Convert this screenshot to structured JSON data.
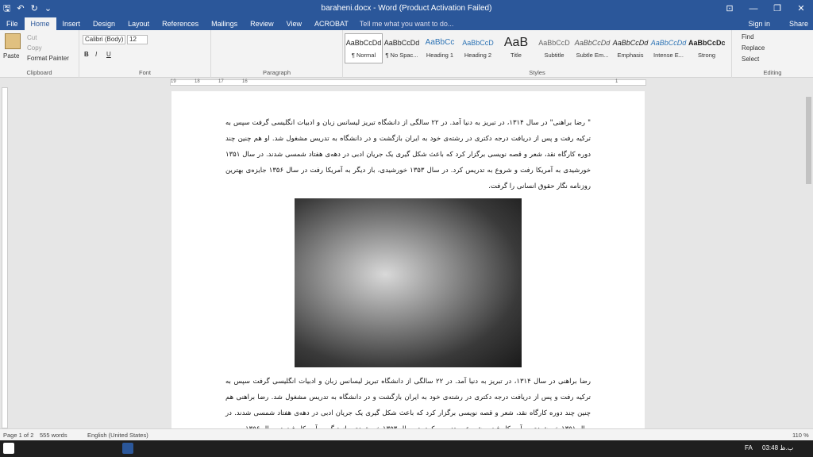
{
  "window": {
    "title": "baraheni.docx - Word (Product Activation Failed)",
    "controls": [
      "⊡",
      "—",
      "❐",
      "✕"
    ]
  },
  "qat": {
    "save": "🖫",
    "undo": "↶",
    "redo": "↻",
    "more": "⌄"
  },
  "tabs": [
    "File",
    "Home",
    "Insert",
    "Design",
    "Layout",
    "References",
    "Mailings",
    "Review",
    "View",
    "ACROBAT"
  ],
  "active_tab": "Home",
  "tellme": "Tell me what you want to do...",
  "signin": "Sign in",
  "share": "Share",
  "clipboard": {
    "paste": "Paste",
    "cut": "Cut",
    "copy": "Copy",
    "format_painter": "Format Painter",
    "label": "Clipboard"
  },
  "font": {
    "name": "Calibri (Body)",
    "size": "12",
    "label": "Font",
    "bold": "B",
    "italic": "I",
    "underline": "U"
  },
  "paragraph": {
    "label": "Paragraph"
  },
  "styles": {
    "label": "Styles",
    "items": [
      {
        "preview": "AaBbCcDd",
        "name": "¶ Normal"
      },
      {
        "preview": "AaBbCcDd",
        "name": "¶ No Spac..."
      },
      {
        "preview": "AaBbCc",
        "name": "Heading 1"
      },
      {
        "preview": "AaBbCcD",
        "name": "Heading 2"
      },
      {
        "preview": "AaB",
        "name": "Title"
      },
      {
        "preview": "AaBbCcD",
        "name": "Subtitle"
      },
      {
        "preview": "AaBbCcDd",
        "name": "Subtle Em..."
      },
      {
        "preview": "AaBbCcDd",
        "name": "Emphasis"
      },
      {
        "preview": "AaBbCcDd",
        "name": "Intense E..."
      },
      {
        "preview": "AaBbCcDc",
        "name": "Strong"
      }
    ]
  },
  "editing": {
    "find": "Find",
    "replace": "Replace",
    "select": "Select",
    "label": "Editing"
  },
  "ruler": {
    "ticks": [
      "19",
      "18",
      "17",
      "16",
      "15",
      "14",
      "13",
      "12",
      "11",
      "10",
      "9",
      "8",
      "7",
      "6",
      "5",
      "4",
      "3",
      "2",
      "1"
    ]
  },
  "document": {
    "para1": "\" رضا براهنی\" در سال ۱۳۱۴، در تبریز به دنیا آمد. در ۲۲ سالگی از دانشگاه تبریز لیسانس زبان و ادبیات انگلیسی گرفت سپس به ترکیه رفت و پس از دریافت درجه دکتری در رشته‌ی خود به ایران بازگشت و در دانشگاه به تدریس مشغول شد. او هم چنین چند دوره کارگاه نقد، شعر و قصه نویسی برگزار کرد که باعث شکل گیری یک جریان ادبی در دهه‌ی هفتاد شمسی شدند. در سال ۱۳۵۱ خورشیدی به آمریکا رفت و شروع به تدریس کرد. در سال ۱۳۵۳ خورشیدی، باز دیگر به آمریکا رفت در سال ۱۳۵۶ جایزه‌ی بهترین روزنامه نگار حقوق انسانی را گرفت.",
    "para2": "رضا براهنی در سال ۱۳۱۴، در تبریز به دنیا آمد. در ۲۲ سالگی از دانشگاه تبریز لیسانس زبان و ادبیات انگلیسی گرفت سپس به ترکیه رفت و پس از دریافت درجه دکتری در رشته‌ی خود به ایران بازگشت و در دانشگاه به تدریس مشغول شد. رضا براهنی هم چنین چند دوره کارگاه نقد، شعر و قصه نویسی برگزار کرد که باعث شکل گیری یک جریان ادبی در دهه‌ی هفتاد شمسی شدند. در سال ۱۳۵۱ خورشیدی به آمریکا رفت و شروع به تدریس کرد. در سال ۱۳۵۳ خورشیدی، باز دیگر به آمریکا رفت در سال ۱۳۵۶"
  },
  "status": {
    "page": "Page 1 of 2",
    "words": "555 words",
    "language": "English (United States)",
    "zoom": "110 %"
  },
  "taskbar": {
    "lang": "FA",
    "time": "03:48 ب.ظ"
  }
}
